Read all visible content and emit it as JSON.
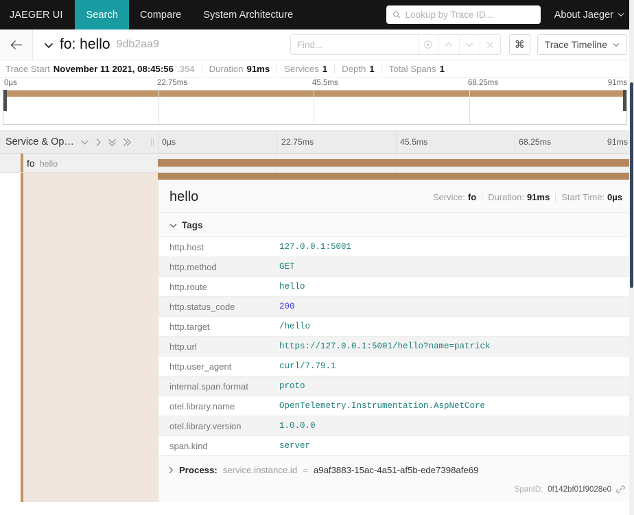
{
  "topnav": {
    "brand": "JAEGER UI",
    "items": [
      {
        "label": "Search",
        "active": true
      },
      {
        "label": "Compare",
        "active": false
      },
      {
        "label": "System Architecture",
        "active": false
      }
    ],
    "traceid_search": {
      "placeholder": "Lookup by Trace ID...",
      "value": "",
      "icon": "search-icon"
    },
    "about": {
      "label": "About Jaeger",
      "icon": "chevron-down-icon"
    },
    "accent_color": "#199ca1",
    "background_color": "#151515"
  },
  "trace_header": {
    "back_icon": "arrow-left-icon",
    "collapse_icon": "chevron-down-icon",
    "title": "fo: hello",
    "short_id": "9db2aa9",
    "find": {
      "placeholder": "Find...",
      "value": ""
    },
    "find_buttons": [
      "target-icon",
      "chevron-up-icon",
      "chevron-down-icon",
      "close-icon"
    ],
    "keyboard_shortcut_icon": "command-icon",
    "view_selector": {
      "label": "Trace Timeline",
      "icon": "chevron-down-icon"
    }
  },
  "summary": {
    "trace_start_label": "Trace Start",
    "trace_start_value": "November 11 2021, 08:45:56",
    "trace_start_millis": ".354",
    "duration_label": "Duration",
    "duration_value": "91ms",
    "services_label": "Services",
    "services_value": "1",
    "depth_label": "Depth",
    "depth_value": "1",
    "total_spans_label": "Total Spans",
    "total_spans_value": "1"
  },
  "timeline": {
    "ticks": [
      "0µs",
      "22.75ms",
      "45.5ms",
      "68.25ms",
      "91ms"
    ],
    "span_color": "#b4885c",
    "minimap_bar_color": "#bf9467"
  },
  "column_header": {
    "label": "Service & Op…",
    "icons": [
      "chevron-down-icon",
      "chevron-right-icon",
      "double-chevron-down-icon",
      "double-chevron-right-icon"
    ],
    "resizer_icon": "column-resizer-icon"
  },
  "span_row": {
    "service": "fo",
    "operation": "hello"
  },
  "span_detail": {
    "operation_name": "hello",
    "service_label": "Service:",
    "service_value": "fo",
    "duration_label": "Duration:",
    "duration_value": "91ms",
    "start_time_label": "Start Time:",
    "start_time_value": "0µs",
    "tags_section_label": "Tags",
    "tags_chevron": "chevron-down-icon",
    "tags": [
      {
        "key": "http.host",
        "value": "127.0.0.1:5001",
        "type": "string"
      },
      {
        "key": "http.method",
        "value": "GET",
        "type": "string"
      },
      {
        "key": "http.route",
        "value": "hello",
        "type": "string"
      },
      {
        "key": "http.status_code",
        "value": "200",
        "type": "number"
      },
      {
        "key": "http.target",
        "value": "/hello",
        "type": "string"
      },
      {
        "key": "http.url",
        "value": "https://127.0.0.1:5001/hello?name=patrick",
        "type": "string"
      },
      {
        "key": "http.user_agent",
        "value": "curl/7.79.1",
        "type": "string"
      },
      {
        "key": "internal.span.format",
        "value": "proto",
        "type": "string"
      },
      {
        "key": "otel.library.name",
        "value": "OpenTelemetry.Instrumentation.AspNetCore",
        "type": "string"
      },
      {
        "key": "otel.library.version",
        "value": "1.0.0.0",
        "type": "string"
      },
      {
        "key": "span.kind",
        "value": "server",
        "type": "string"
      }
    ],
    "process": {
      "chevron": "chevron-right-icon",
      "label": "Process:",
      "key": "service.instance.id",
      "eq": "=",
      "value": "a9af3883-15ac-4a51-af5b-ede7398afe69"
    },
    "span_id": {
      "label": "SpanID:",
      "value": "0f142bf01f9028e0",
      "icon": "link-icon"
    }
  }
}
